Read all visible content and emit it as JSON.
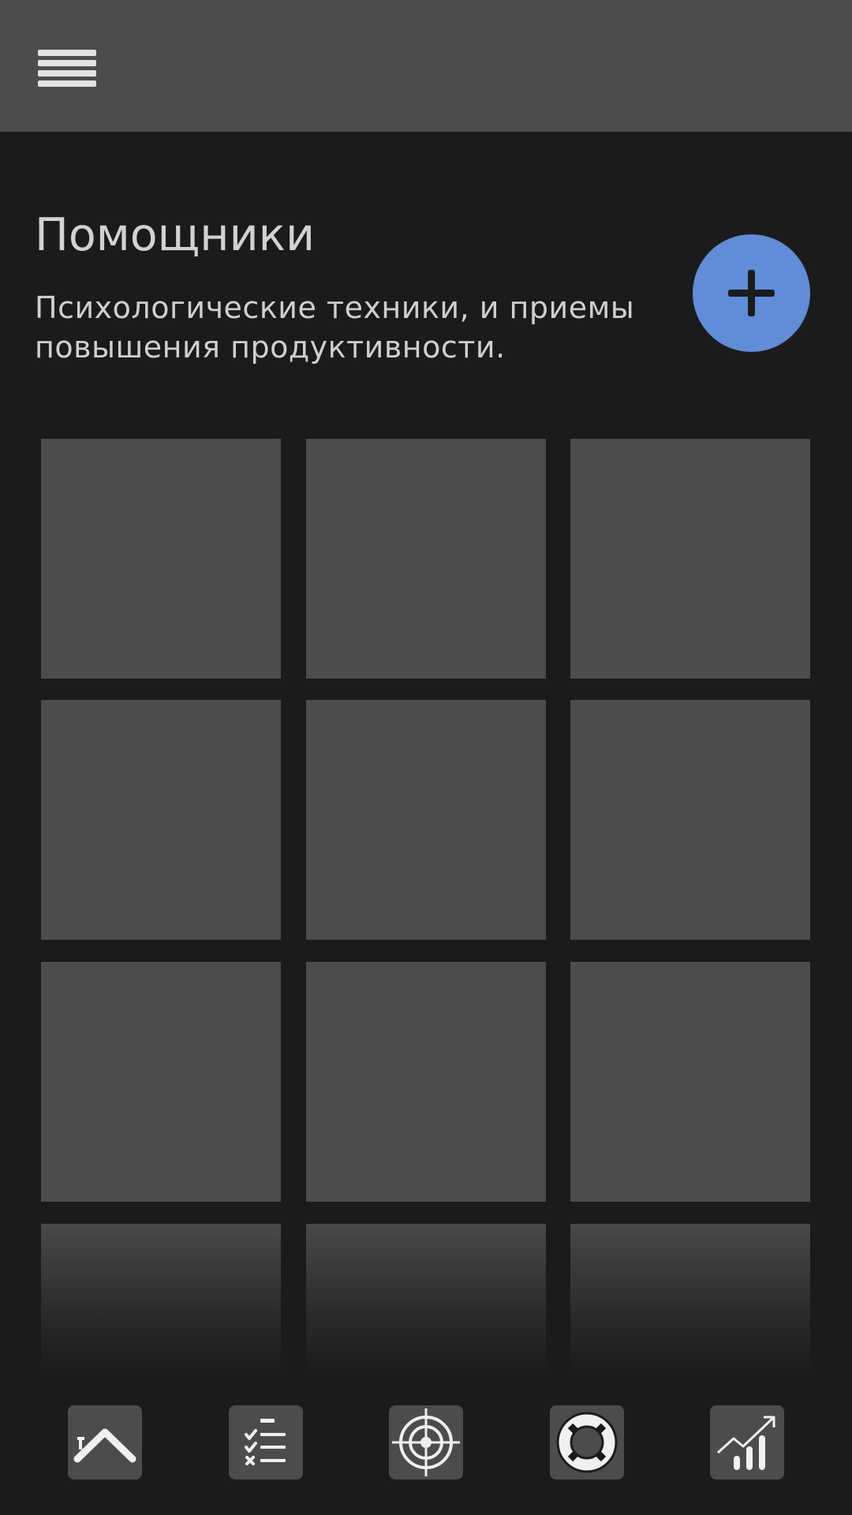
{
  "header": {
    "menu_icon": "hamburger-menu-icon"
  },
  "page": {
    "title": "Помощники",
    "subtitle": "Психологические техники, и приемы повышения продуктивности."
  },
  "fab": {
    "icon": "plus-icon",
    "color": "#608cd8"
  },
  "grid": {
    "columns": 3,
    "rows_visible": 4,
    "tile_color": "#4c4c4c"
  },
  "bottom_nav": {
    "items": [
      {
        "icon": "home-icon"
      },
      {
        "icon": "checklist-icon"
      },
      {
        "icon": "target-icon"
      },
      {
        "icon": "lifebuoy-icon"
      },
      {
        "icon": "growth-chart-icon"
      }
    ]
  },
  "colors": {
    "background": "#1b1b1b",
    "surface": "#4c4c4c",
    "accent": "#608cd8",
    "text": "#d2d2d2"
  }
}
